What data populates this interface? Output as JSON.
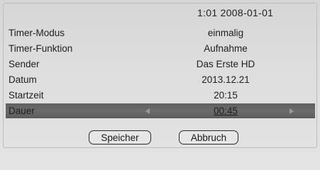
{
  "header": {
    "clock": "1:01 2008-01-01"
  },
  "fields": [
    {
      "label": "Timer-Modus",
      "value": "einmalig"
    },
    {
      "label": "Timer-Funktion",
      "value": "Aufnahme"
    },
    {
      "label": "Sender",
      "value": "Das Erste HD"
    },
    {
      "label": "Datum",
      "value": "2013.12.21"
    },
    {
      "label": "Startzeit",
      "value": "20:15"
    },
    {
      "label": "Dauer",
      "value": "00:45"
    }
  ],
  "selected_field": "Dauer",
  "buttons": {
    "save_label": "Speicher",
    "cancel_label": "Abbruch"
  },
  "icons": {
    "left": "arrow-left-icon",
    "right": "arrow-right-icon"
  },
  "colors": {
    "selected_row": "#656565",
    "background": "#dcdcdc"
  }
}
